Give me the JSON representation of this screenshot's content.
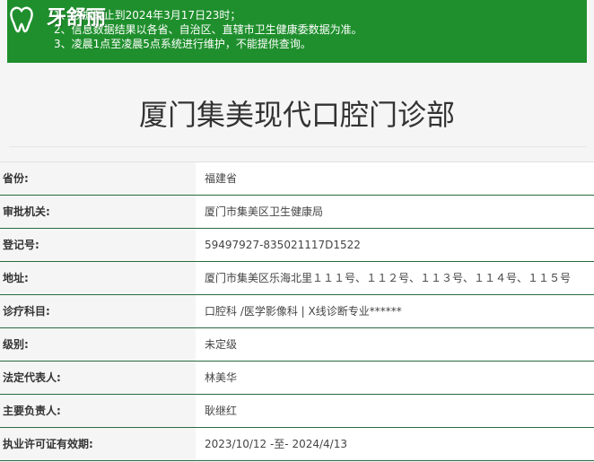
{
  "notice": {
    "lines": [
      "1、数据截止到2024年3月17日23时；",
      "2、信息数据结果以各省、自治区、直辖市卫生健康委数据为准。",
      "3、凌晨1点至凌晨5点系统进行维护，不能提供查询。"
    ]
  },
  "logo": {
    "text": "牙舒丽"
  },
  "page": {
    "title": "厦门集美现代口腔门诊部"
  },
  "info": [
    {
      "label": "省份:",
      "value": "福建省"
    },
    {
      "label": "审批机关:",
      "value": "厦门市集美区卫生健康局"
    },
    {
      "label": "登记号:",
      "value": "59497927-835021117D1522"
    },
    {
      "label": "地址:",
      "value": "厦门市集美区乐海北里１１１号、１１２号、１１３号、１１４号、１１５号"
    },
    {
      "label": "诊疗科目:",
      "value": "口腔科 /医学影像科 | X线诊断专业******"
    },
    {
      "label": "级别:",
      "value": "未定级"
    },
    {
      "label": "法定代表人:",
      "value": "林美华"
    },
    {
      "label": "主要负责人:",
      "value": "耿继红"
    },
    {
      "label": "执业许可证有效期:",
      "value": "2023/10/12 -至- 2024/4/13"
    }
  ],
  "colors": {
    "notice_bg": "#1f8f2d",
    "row_border": "#2a6a40"
  }
}
